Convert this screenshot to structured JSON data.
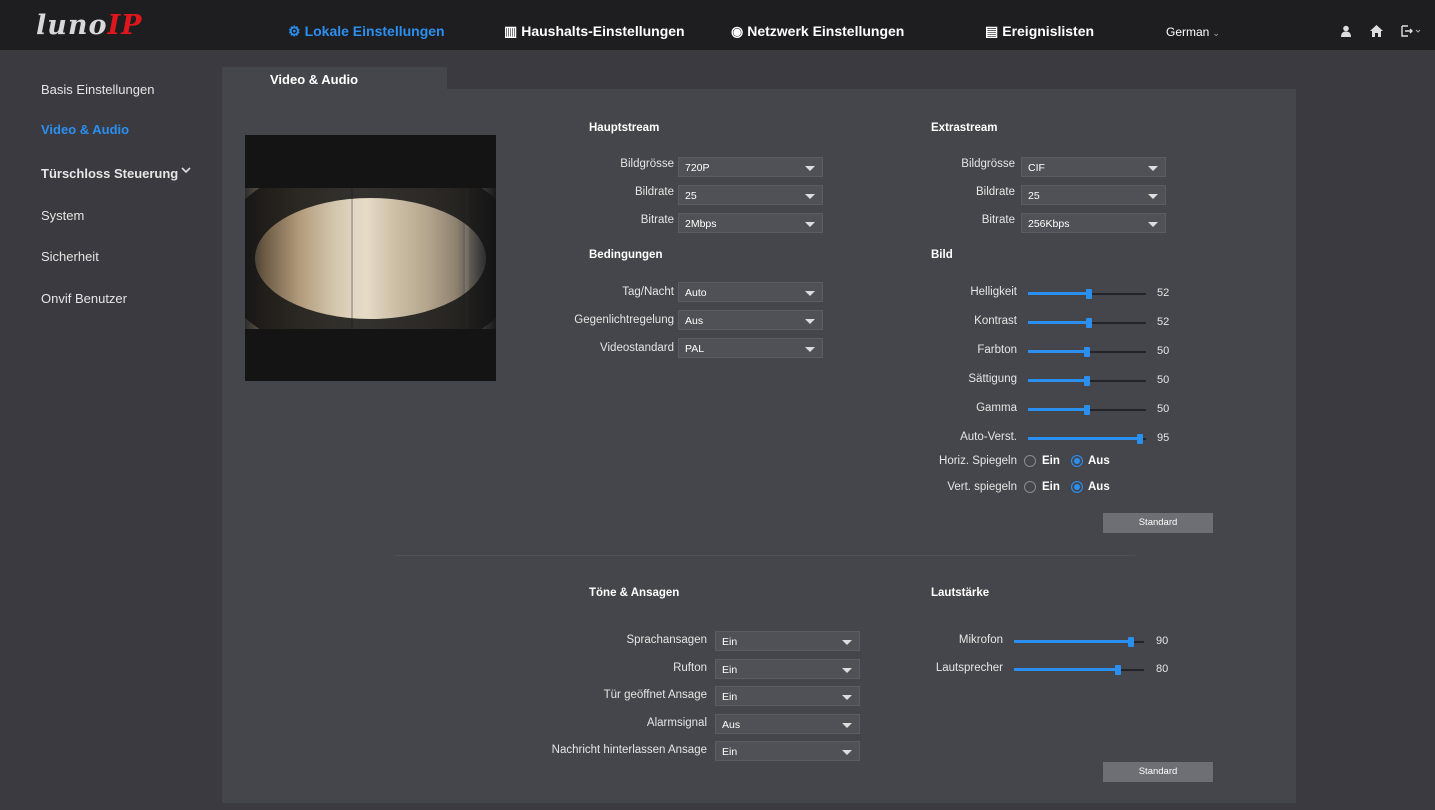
{
  "header": {
    "logo_text": "luno",
    "logo_accent": "IP",
    "nav": [
      {
        "label": "Lokale Einstellungen",
        "icon": "gear-icon",
        "active": true
      },
      {
        "label": "Haushalts-Einstellungen",
        "icon": "building-icon",
        "active": false
      },
      {
        "label": "Netzwerk Einstellungen",
        "icon": "globe-icon",
        "active": false
      },
      {
        "label": "Ereignislisten",
        "icon": "list-icon",
        "active": false
      }
    ],
    "language": "German",
    "icons": [
      "user-icon",
      "home-icon",
      "logout-icon"
    ]
  },
  "sidebar": {
    "items": [
      {
        "label": "Basis Einstellungen"
      },
      {
        "label": "Video & Audio"
      },
      {
        "label": "Türschloss Steuerung"
      },
      {
        "label": "System"
      },
      {
        "label": "Sicherheit"
      },
      {
        "label": "Onvif Benutzer"
      }
    ]
  },
  "tab": {
    "label": "Video & Audio"
  },
  "hauptstream": {
    "title": "Hauptstream",
    "bildgroesse_label": "Bildgrösse",
    "bildgroesse": "720P",
    "bildrate_label": "Bildrate",
    "bildrate": "25",
    "bitrate_label": "Bitrate",
    "bitrate": "2Mbps"
  },
  "extrastream": {
    "title": "Extrastream",
    "bildgroesse_label": "Bildgrösse",
    "bildgroesse": "CIF",
    "bildrate_label": "Bildrate",
    "bildrate": "25",
    "bitrate_label": "Bitrate",
    "bitrate": "256Kbps"
  },
  "bedingungen": {
    "title": "Bedingungen",
    "tagnacht_label": "Tag/Nacht",
    "tagnacht": "Auto",
    "gegenlicht_label": "Gegenlichtregelung",
    "gegenlicht": "Aus",
    "videostandard_label": "Videostandard",
    "videostandard": "PAL"
  },
  "bild": {
    "title": "Bild",
    "sliders": [
      {
        "label": "Helligkeit",
        "value": 52
      },
      {
        "label": "Kontrast",
        "value": 52
      },
      {
        "label": "Farbton",
        "value": 50
      },
      {
        "label": "Sättigung",
        "value": 50
      },
      {
        "label": "Gamma",
        "value": 50
      },
      {
        "label": "Auto-Verst.",
        "value": 95
      }
    ],
    "horiz_label": "Horiz. Spiegeln",
    "vert_label": "Vert. spiegeln",
    "ein": "Ein",
    "aus": "Aus",
    "horiz_selected": "Aus",
    "vert_selected": "Aus",
    "standard": "Standard"
  },
  "toene": {
    "title": "Töne & Ansagen",
    "rows": [
      {
        "label": "Sprachansagen",
        "value": "Ein"
      },
      {
        "label": "Rufton",
        "value": "Ein"
      },
      {
        "label": "Tür geöffnet Ansage",
        "value": "Ein"
      },
      {
        "label": "Alarmsignal",
        "value": "Aus"
      },
      {
        "label": "Nachricht hinterlassen Ansage",
        "value": "Ein"
      }
    ]
  },
  "lautstaerke": {
    "title": "Lautstärke",
    "sliders": [
      {
        "label": "Mikrofon",
        "value": 90
      },
      {
        "label": "Lautsprecher",
        "value": 80
      }
    ],
    "standard": "Standard"
  },
  "colors": {
    "accent": "#2b8ff0",
    "logo_red": "#e0161d",
    "panel": "#45454c"
  }
}
